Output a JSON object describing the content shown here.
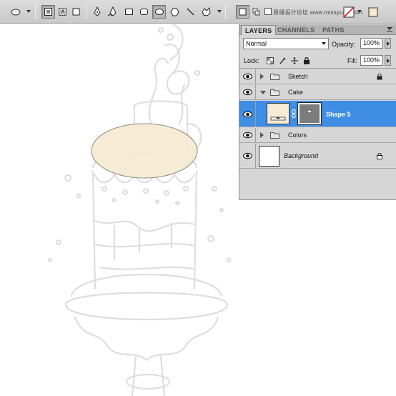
{
  "options_bar": {
    "tools": [
      "ellipse-tool-preset-icon",
      "shape-layers-icon",
      "paths-icon",
      "fill-pixels-icon",
      "pen-tool-icon",
      "freeform-pen-icon",
      "rectangle-tool-icon",
      "rounded-rectangle-tool-icon",
      "ellipse-tool-icon",
      "polygon-tool-icon",
      "line-tool-icon",
      "custom-shape-icon"
    ],
    "watermark_text": "思缘设计论坛 www.missyuan.com"
  },
  "layers_panel": {
    "tabs": [
      "LAYERS",
      "CHANNELS",
      "PATHS"
    ],
    "active_tab": "LAYERS",
    "blend_mode": "Normal",
    "opacity_label": "Opacity:",
    "opacity_value": "100%",
    "lock_label": "Lock:",
    "fill_label": "Fill:",
    "fill_value": "100%",
    "layers": [
      {
        "name": "Sketch",
        "type": "group",
        "expanded": false,
        "locked": true,
        "visible": true
      },
      {
        "name": "Cake",
        "type": "group",
        "expanded": true,
        "locked": false,
        "visible": true
      },
      {
        "name": "Shape 5",
        "type": "shape",
        "selected": true,
        "visible": true,
        "fill_color": "#f6ecd6"
      },
      {
        "name": "Colors",
        "type": "group",
        "expanded": false,
        "locked": false,
        "visible": true
      },
      {
        "name": "Background",
        "type": "background",
        "locked": true,
        "visible": true,
        "italic": true
      }
    ]
  },
  "canvas": {
    "ellipse_fill": "#f5ead2",
    "ellipse_stroke": "#8e8a80",
    "sketch_color": "#dcdcdc"
  },
  "colors": {
    "selection_blue": "#3e8ee6",
    "panel_bg": "#d6d6d6",
    "toolbar_bg": "#d2d2d2"
  }
}
